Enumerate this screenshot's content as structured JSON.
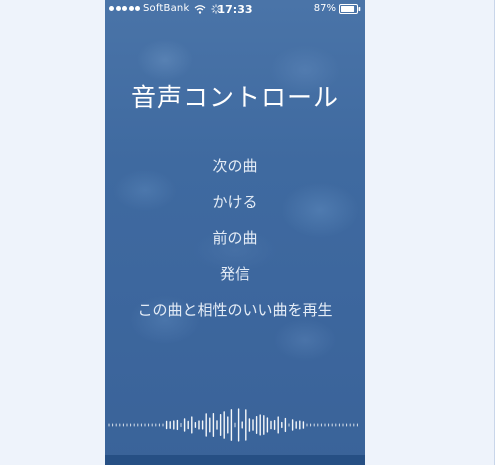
{
  "status_bar": {
    "carrier": "SoftBank",
    "time": "17:33",
    "battery_percent": "87%",
    "battery_level": 0.87,
    "icons": [
      "signal-dots-icon",
      "wifi-icon",
      "activity-icon",
      "battery-icon"
    ]
  },
  "voice_control": {
    "title": "音声コントロール",
    "suggestions": [
      "次の曲",
      "かける",
      "前の曲",
      "発信",
      "この曲と相性のいい曲を再生"
    ]
  },
  "colors": {
    "background_blue": "#3f6aa0",
    "text_white": "#ffffff",
    "page_background": "#eef3fb"
  }
}
